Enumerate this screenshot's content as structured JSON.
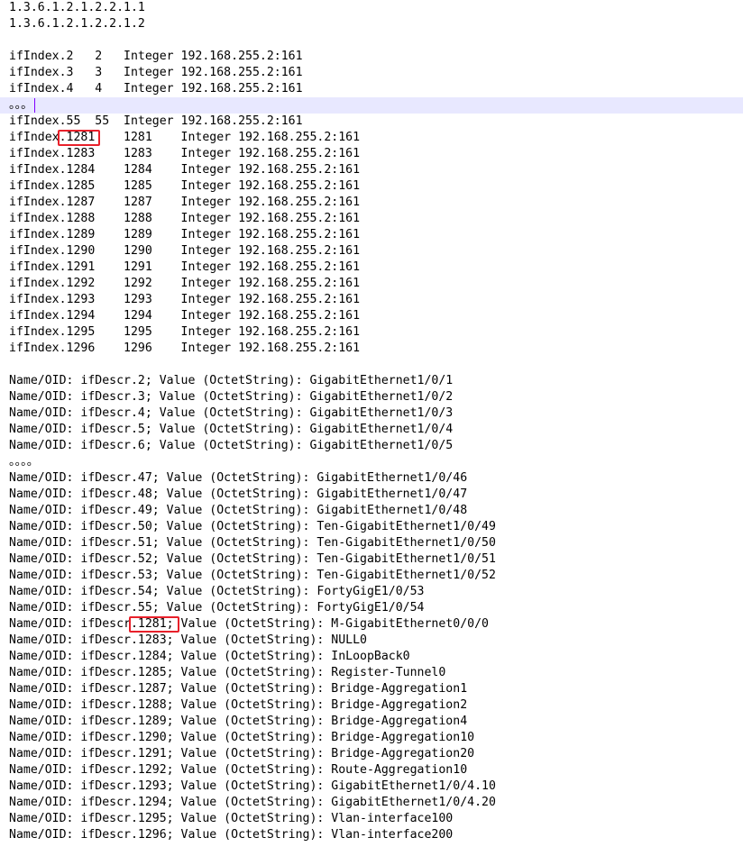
{
  "lines": [
    "1.3.6.1.2.1.2.2.1.1",
    "1.3.6.1.2.1.2.2.1.2",
    "",
    "ifIndex.2   2   Integer 192.168.255.2:161",
    "ifIndex.3   3   Integer 192.168.255.2:161",
    "ifIndex.4   4   Integer 192.168.255.2:161",
    "。。。",
    "ifIndex.55  55  Integer 192.168.255.2:161",
    "ifIndex.1281    1281    Integer 192.168.255.2:161",
    "ifIndex.1283    1283    Integer 192.168.255.2:161",
    "ifIndex.1284    1284    Integer 192.168.255.2:161",
    "ifIndex.1285    1285    Integer 192.168.255.2:161",
    "ifIndex.1287    1287    Integer 192.168.255.2:161",
    "ifIndex.1288    1288    Integer 192.168.255.2:161",
    "ifIndex.1289    1289    Integer 192.168.255.2:161",
    "ifIndex.1290    1290    Integer 192.168.255.2:161",
    "ifIndex.1291    1291    Integer 192.168.255.2:161",
    "ifIndex.1292    1292    Integer 192.168.255.2:161",
    "ifIndex.1293    1293    Integer 192.168.255.2:161",
    "ifIndex.1294    1294    Integer 192.168.255.2:161",
    "ifIndex.1295    1295    Integer 192.168.255.2:161",
    "ifIndex.1296    1296    Integer 192.168.255.2:161",
    "",
    "Name/OID: ifDescr.2; Value (OctetString): GigabitEthernet1/0/1",
    "Name/OID: ifDescr.3; Value (OctetString): GigabitEthernet1/0/2",
    "Name/OID: ifDescr.4; Value (OctetString): GigabitEthernet1/0/3",
    "Name/OID: ifDescr.5; Value (OctetString): GigabitEthernet1/0/4",
    "Name/OID: ifDescr.6; Value (OctetString): GigabitEthernet1/0/5",
    "。。。。",
    "Name/OID: ifDescr.47; Value (OctetString): GigabitEthernet1/0/46",
    "Name/OID: ifDescr.48; Value (OctetString): GigabitEthernet1/0/47",
    "Name/OID: ifDescr.49; Value (OctetString): GigabitEthernet1/0/48",
    "Name/OID: ifDescr.50; Value (OctetString): Ten-GigabitEthernet1/0/49",
    "Name/OID: ifDescr.51; Value (OctetString): Ten-GigabitEthernet1/0/50",
    "Name/OID: ifDescr.52; Value (OctetString): Ten-GigabitEthernet1/0/51",
    "Name/OID: ifDescr.53; Value (OctetString): Ten-GigabitEthernet1/0/52",
    "Name/OID: ifDescr.54; Value (OctetString): FortyGigE1/0/53",
    "Name/OID: ifDescr.55; Value (OctetString): FortyGigE1/0/54",
    "Name/OID: ifDescr.1281; Value (OctetString): M-GigabitEthernet0/0/0",
    "Name/OID: ifDescr.1283; Value (OctetString): NULL0",
    "Name/OID: ifDescr.1284; Value (OctetString): InLoopBack0",
    "Name/OID: ifDescr.1285; Value (OctetString): Register-Tunnel0",
    "Name/OID: ifDescr.1287; Value (OctetString): Bridge-Aggregation1",
    "Name/OID: ifDescr.1288; Value (OctetString): Bridge-Aggregation2",
    "Name/OID: ifDescr.1289; Value (OctetString): Bridge-Aggregation4",
    "Name/OID: ifDescr.1290; Value (OctetString): Bridge-Aggregation10",
    "Name/OID: ifDescr.1291; Value (OctetString): Bridge-Aggregation20",
    "Name/OID: ifDescr.1292; Value (OctetString): Route-Aggregation10",
    "Name/OID: ifDescr.1293; Value (OctetString): GigabitEthernet1/0/4.10",
    "Name/OID: ifDescr.1294; Value (OctetString): GigabitEthernet1/0/4.20",
    "Name/OID: ifDescr.1295; Value (OctetString): Vlan-interface100",
    "Name/OID: ifDescr.1296; Value (OctetString): Vlan-interface200"
  ],
  "current_line_index": 6,
  "annotations": [
    {
      "line_index": 8,
      "text": "1281"
    },
    {
      "line_index": 38,
      "text": "1281;"
    }
  ],
  "colors": {
    "text": "#000000",
    "current_line_bg": "#e8e8ff",
    "caret": "#8000ff",
    "annotation_box": "#e8202a"
  }
}
